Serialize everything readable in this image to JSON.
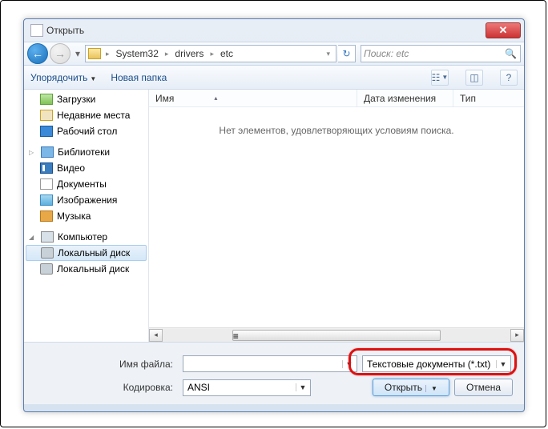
{
  "window": {
    "title": "Открыть"
  },
  "nav": {
    "crumb1": "System32",
    "crumb2": "drivers",
    "crumb3": "etc",
    "search_placeholder": "Поиск: etc"
  },
  "toolbar": {
    "organize": "Упорядочить",
    "new_folder": "Новая папка"
  },
  "sidebar": {
    "downloads": "Загрузки",
    "recent": "Недавние места",
    "desktop": "Рабочий стол",
    "libraries": "Библиотеки",
    "video": "Видео",
    "documents": "Документы",
    "images": "Изображения",
    "music": "Музыка",
    "computer": "Компьютер",
    "localdisk1": "Локальный диск",
    "localdisk2": "Локальный диск"
  },
  "columns": {
    "name": "Имя",
    "date": "Дата изменения",
    "type": "Тип"
  },
  "main": {
    "empty": "Нет элементов, удовлетворяющих условиям поиска."
  },
  "bottom": {
    "filename_label": "Имя файла:",
    "encoding_label": "Кодировка:",
    "filetype_value": "Текстовые документы (*.txt)",
    "encoding_value": "ANSI",
    "open": "Открыть",
    "cancel": "Отмена"
  }
}
